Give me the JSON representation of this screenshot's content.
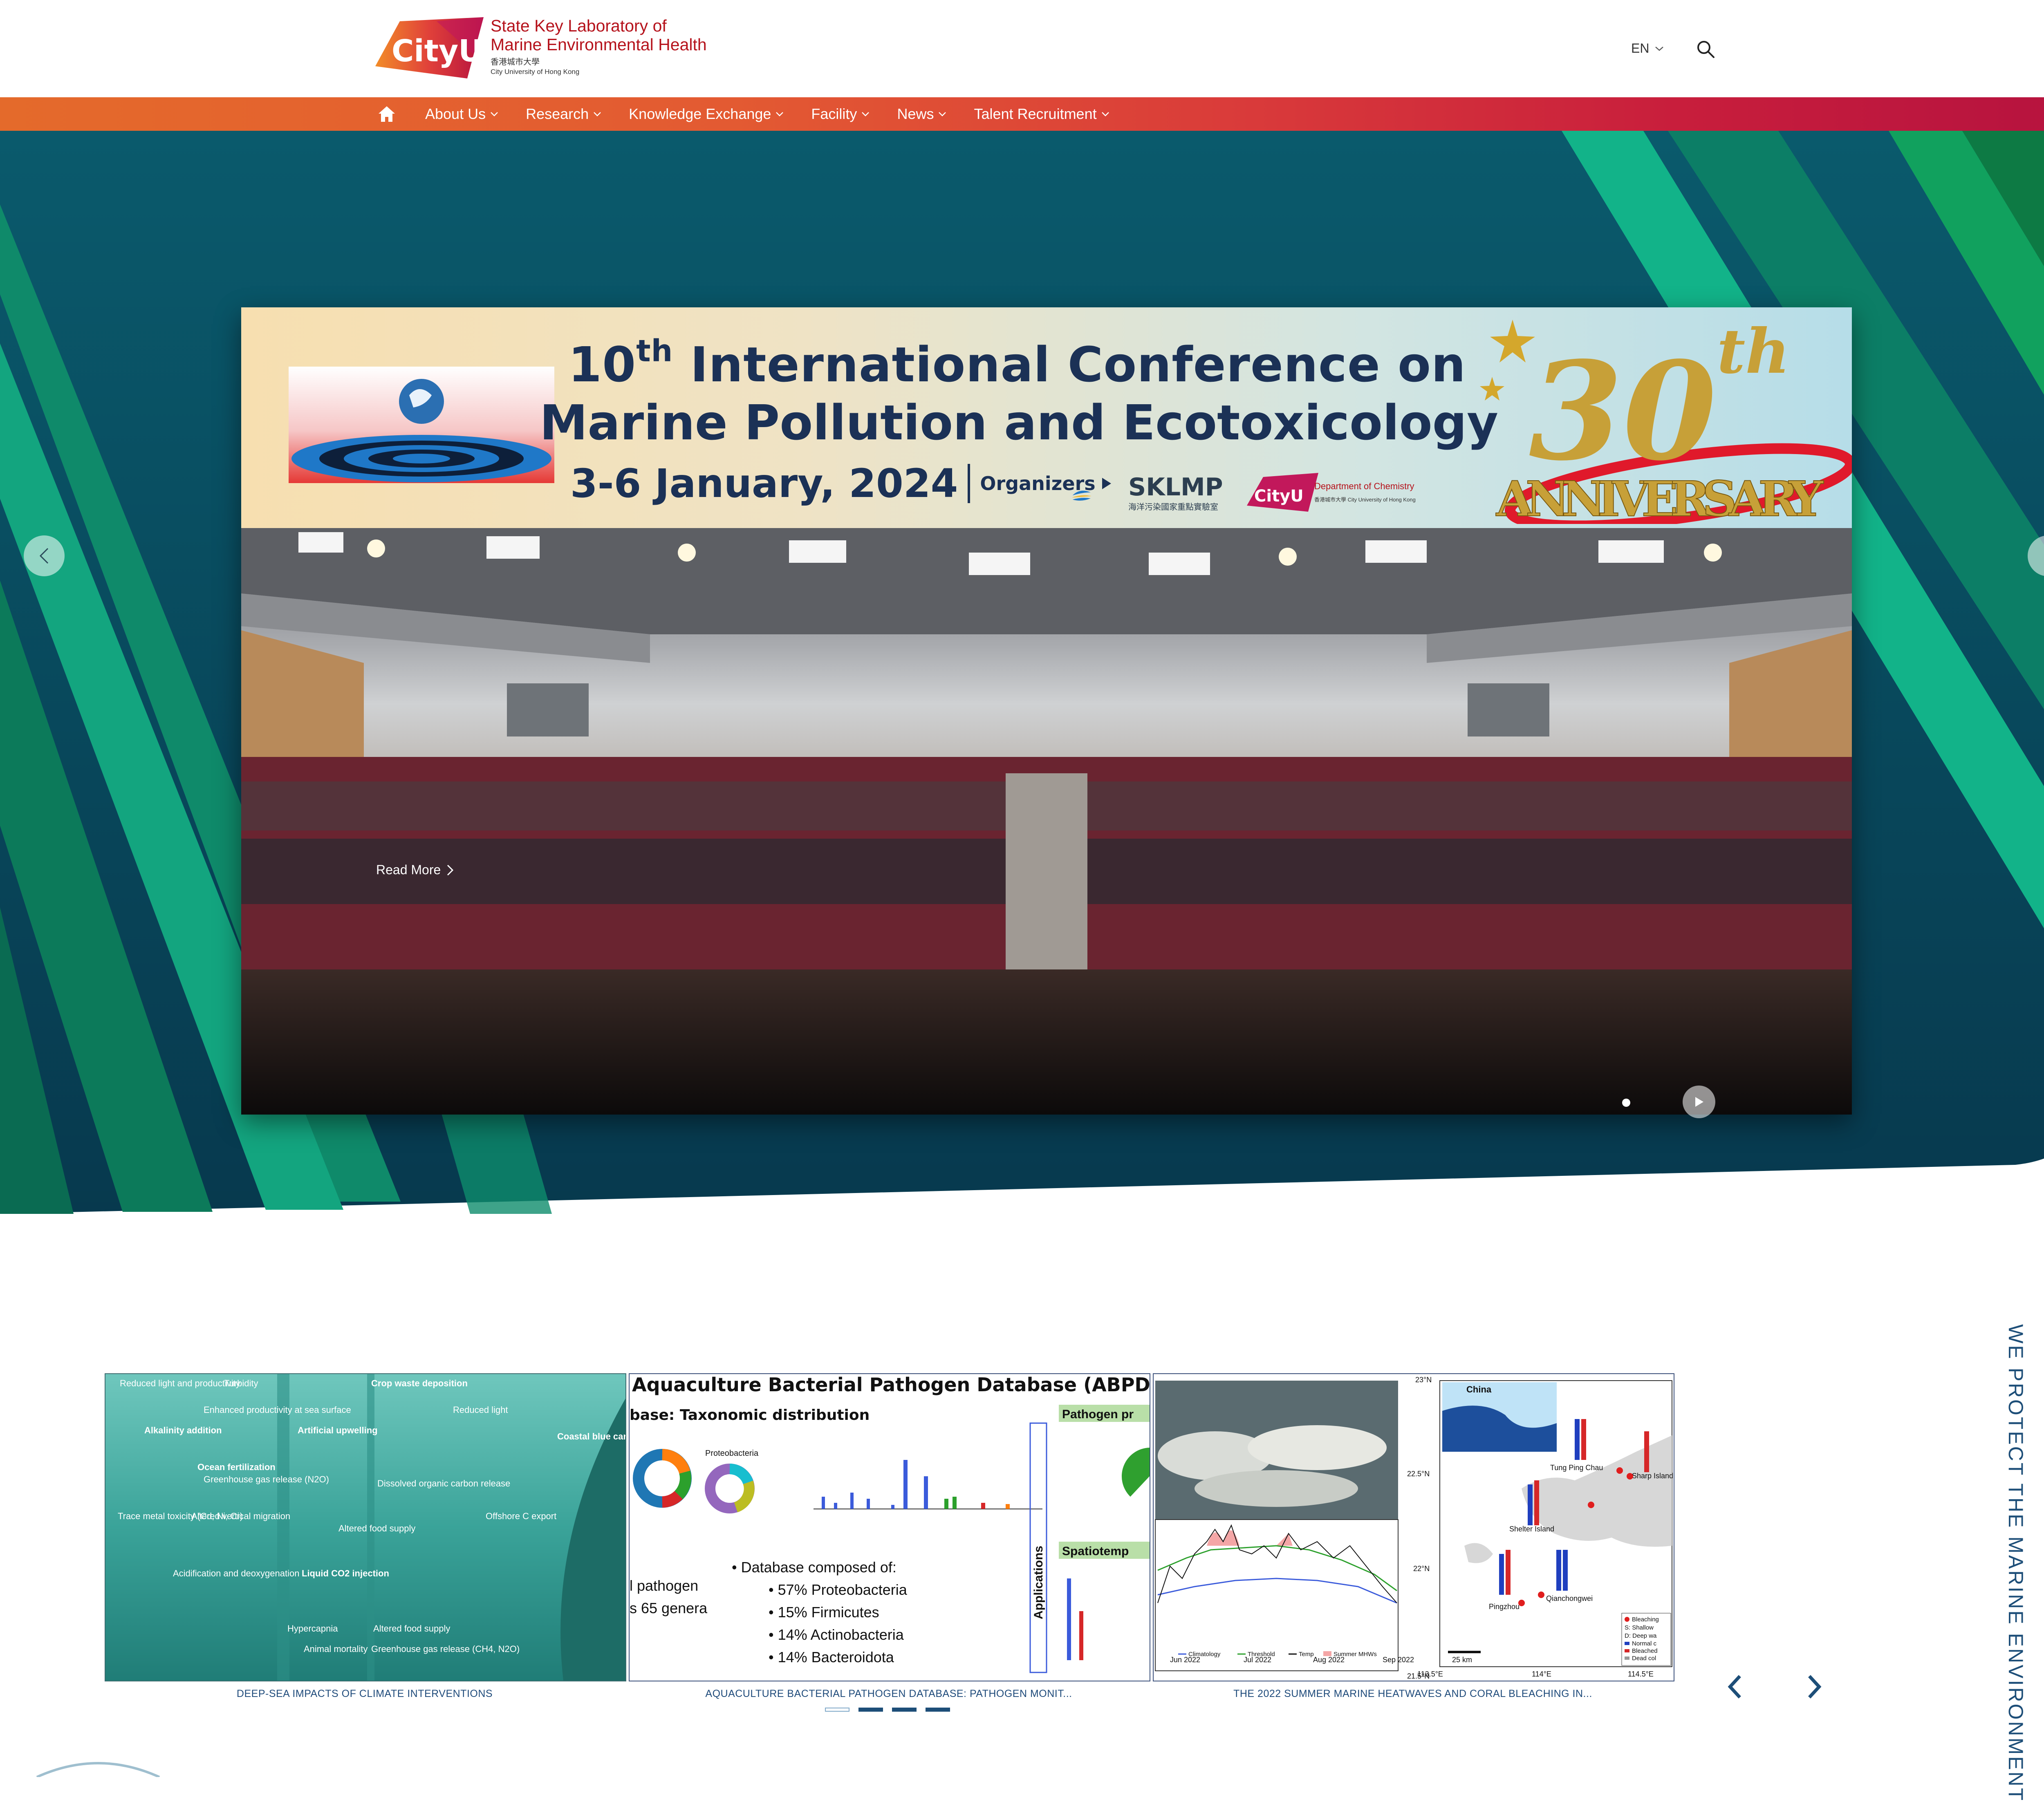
{
  "header": {
    "logo_mark": "CityU",
    "lab_name_line1": "State Key Laboratory of",
    "lab_name_line2": "Marine Environmental Health",
    "university_cn": "香港城市大學",
    "university_en": "City University of Hong Kong",
    "language": "EN"
  },
  "nav": {
    "items": [
      {
        "label": "About Us"
      },
      {
        "label": "Research"
      },
      {
        "label": "Knowledge Exchange"
      },
      {
        "label": "Facility"
      },
      {
        "label": "News"
      },
      {
        "label": "Talent Recruitment"
      }
    ]
  },
  "hero": {
    "banner_line1_num": "10",
    "banner_line1_sup": "th",
    "banner_line1_rest": "International Conference on",
    "banner_line2": "Marine Pollution and Ecotoxicology",
    "banner_date": "3-6 January, 2024",
    "banner_organizers": "Organizers",
    "organizer1": "SKLMP",
    "organizer1_sub": "海洋污染國家重點實驗室",
    "organizer2_logo": "CityU",
    "organizer2": "Department of Chemistry",
    "organizer2_sub": "香港城市大學 City University of Hong Kong",
    "anniversary_num": "30",
    "anniversary_sup": "th",
    "anniversary_word": "ANNIVERSARY",
    "read_more": "Read More",
    "slide_count": 3,
    "active_slide": 2
  },
  "cards": [
    {
      "caption": "DEEP-SEA IMPACTS OF CLIMATE INTERVENTIONS",
      "labels": [
        "Reduced light and productivity",
        "Turbidity",
        "Crop waste deposition",
        "Reduced light",
        "Alkalinity addition",
        "Enhanced productivity at sea surface",
        "Artificial upwelling",
        "Coastal blue carbon",
        "Ocean fertilization",
        "Greenhouse gas release (N2O)",
        "Dissolved organic carbon release",
        "Trace metal toxicity (Cd, Ni, Cr)",
        "Altered vertical migration",
        "Offshore C export",
        "Altered food supply",
        "Acidification and deoxygenation",
        "Liquid CO2 injection",
        "Hypercapnia",
        "Altered food supply",
        "Animal mortality",
        "Greenhouse gas release (CH4, N2O)"
      ]
    },
    {
      "caption": "AQUACULTURE BACTERIAL PATHOGEN DATABASE: PATHOGEN MONIT...",
      "title": "Aquaculture Bacterial Pathogen Database (ABPD)",
      "subtitle": "base: Taxonomic distribution",
      "proteo_label": "Proteobacteria",
      "side_tab1": "Pathogen pr",
      "side_tab2": "Spatiotemp",
      "applications": "Applications",
      "bullet_head": "Database composed of:",
      "bullets": [
        "57% Proteobacteria",
        "15% Firmicutes",
        "14% Actinobacteria",
        "14% Bacteroidota"
      ],
      "left_frag1": "l pathogen",
      "left_frag2": "s 65 genera"
    },
    {
      "caption": "THE 2022 SUMMER MARINE HEATWAVES AND CORAL BLEACHING IN...",
      "map_labels": [
        "China",
        "Tung Ping Chau",
        "Sharp Island",
        "Shelter Island",
        "Pingzhou",
        "Qianchongwei"
      ],
      "lat_labels": [
        "23°N",
        "22.5°N",
        "22°N",
        "21.5°N"
      ],
      "lon_labels": [
        "113.5°E",
        "114°E",
        "114.5°E"
      ],
      "months": [
        "Jun 2022",
        "Jul 2022",
        "Aug 2022",
        "Sep 2022"
      ],
      "legend": [
        "Climatology",
        "Threshold",
        "Temp",
        "Summer MHWs"
      ],
      "map_legend": [
        "Bleaching",
        "S: Shallow",
        "D: Deep wa",
        "Normal c",
        "Bleached",
        "Dead col"
      ],
      "scale": "25 km"
    }
  ],
  "carousel": {
    "pages": 4,
    "active_page": 1
  },
  "side_banner": "WE PROTECT THE MARINE ENVIRONMENT",
  "colors": {
    "brand_red": "#b5121b",
    "nav_start": "#e46a2b",
    "nav_end": "#b5123f",
    "hero_teal": "#0b4a63",
    "caption_blue": "#1e4a7a"
  }
}
